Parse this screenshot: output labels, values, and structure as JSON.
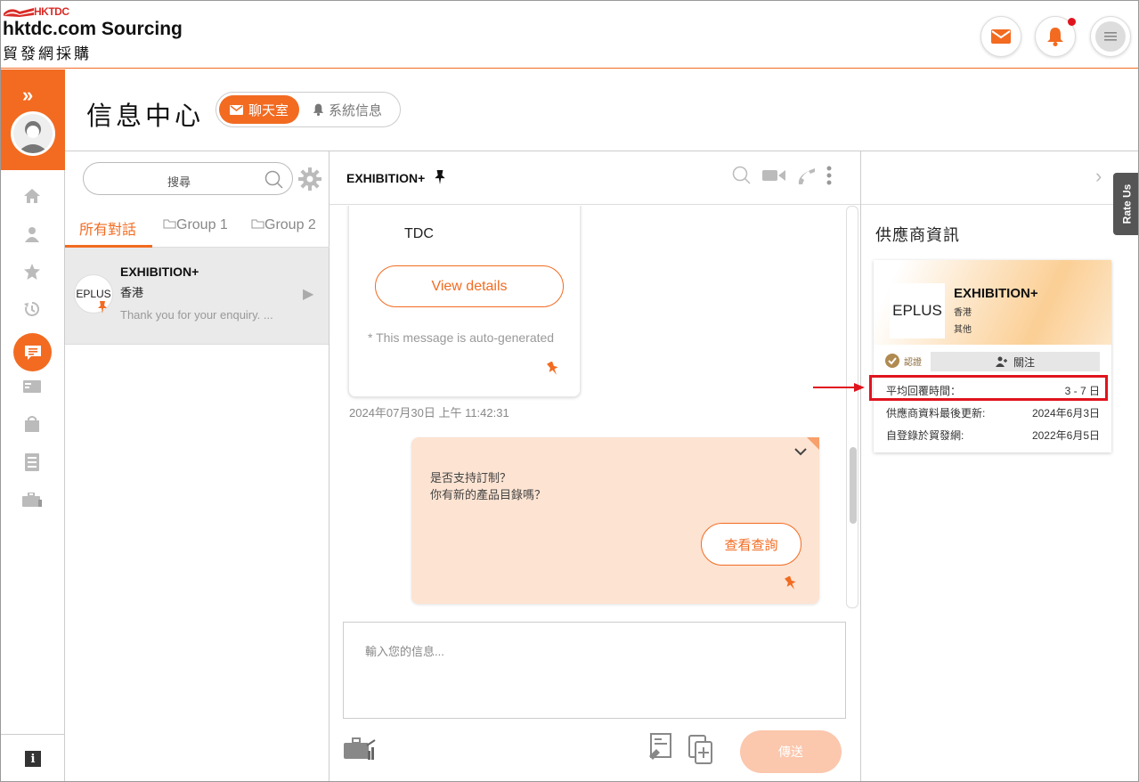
{
  "header": {
    "logo_text": "HKTDC",
    "brand_en": "hktdc.com Sourcing",
    "brand_zh": "貿發網採購",
    "icons": [
      "mail-icon",
      "bell-icon",
      "menu-icon"
    ]
  },
  "page": {
    "title": "信息中心",
    "tabs": [
      {
        "label": "聊天室",
        "active": true
      },
      {
        "label": "系統信息",
        "active": false
      }
    ]
  },
  "conversations": {
    "search_placeholder": "搜尋",
    "tabs": [
      "所有對話",
      "Group 1",
      "Group 2"
    ],
    "items": [
      {
        "avatar_text": "EPLUS",
        "name": "EXHIBITION+",
        "location": "香港",
        "preview": "Thank you for your enquiry. ..."
      }
    ]
  },
  "chat": {
    "title": "EXHIBITION+",
    "incoming": {
      "sender": "TDC",
      "button": "View details",
      "note": "* This message is auto-generated",
      "timestamp": "2024年07月30日 上午 11:42:31"
    },
    "outgoing": {
      "line1": "是否支持訂制？",
      "line2": "你有新的產品目錄嗎？",
      "button": "查看查詢"
    },
    "input_placeholder": "輸入您的信息...",
    "send_label": "傳送"
  },
  "supplier": {
    "section_title": "供應商資訊",
    "logo_text": "EPLUS",
    "name": "EXHIBITION+",
    "location": "香港",
    "category": "其他",
    "verified_label": "認證",
    "follow_label": "關注",
    "rows": [
      {
        "label": "平均回覆時間：",
        "value": "3 - 7 日"
      },
      {
        "label": "供應商資料最後更新:",
        "value": "2024年6月3日"
      },
      {
        "label": "自登錄於貿發網:",
        "value": "2022年6月5日"
      }
    ]
  },
  "rate_us": "Rate Us",
  "colors": {
    "accent": "#f26b21",
    "highlight": "#e0141e",
    "bubble_out": "#fde3d2"
  }
}
